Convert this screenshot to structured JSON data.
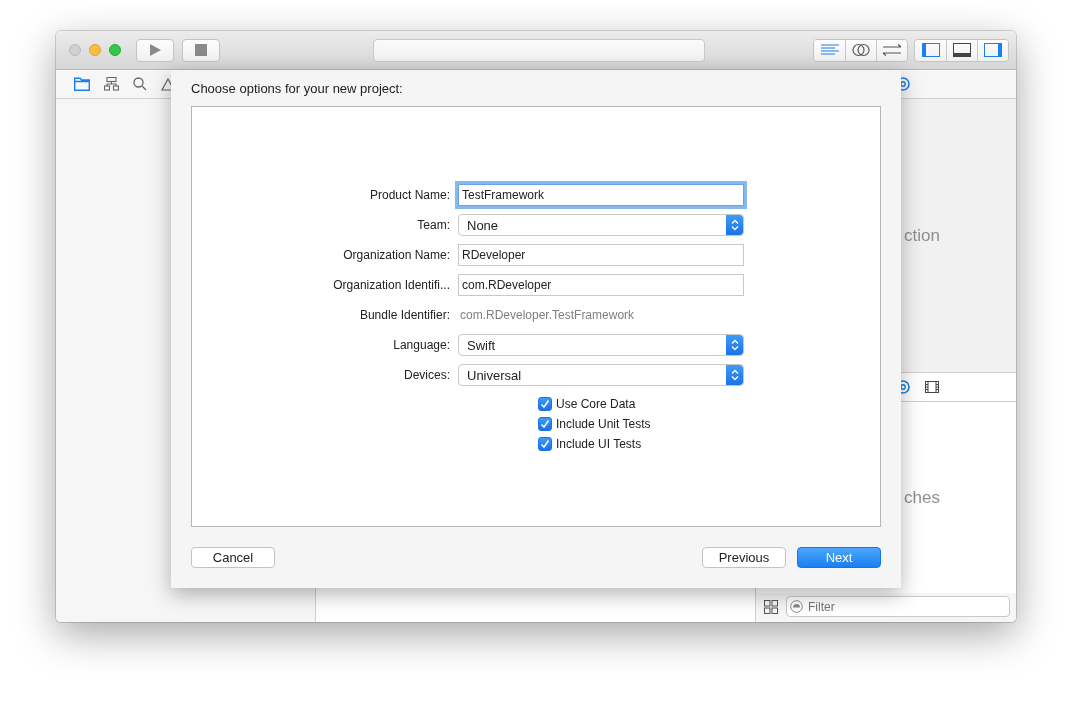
{
  "dialog": {
    "title": "Choose options for your new project:",
    "fields": [
      {
        "kind": "text",
        "label": "Product Name:",
        "value": "TestFramework",
        "focused": true
      },
      {
        "kind": "popup",
        "label": "Team:",
        "value": "None"
      },
      {
        "kind": "text",
        "label": "Organization Name:",
        "value": "RDeveloper",
        "focused": false
      },
      {
        "kind": "text",
        "label": "Organization Identifi...",
        "value": "com.RDeveloper",
        "focused": false
      },
      {
        "kind": "static",
        "label": "Bundle Identifier:",
        "value": "com.RDeveloper.TestFramework"
      },
      {
        "kind": "popup",
        "label": "Language:",
        "value": "Swift"
      },
      {
        "kind": "popup",
        "label": "Devices:",
        "value": "Universal"
      }
    ],
    "checkboxes": [
      {
        "label": "Use Core Data",
        "checked": true
      },
      {
        "label": "Include Unit Tests",
        "checked": true
      },
      {
        "label": "Include UI Tests",
        "checked": true
      }
    ],
    "buttons": [
      {
        "label": "Cancel",
        "kind": "normal"
      },
      {
        "label": "Previous",
        "kind": "normal"
      },
      {
        "label": "Next",
        "kind": "default"
      }
    ]
  },
  "inspector": {
    "upper_text": "ction",
    "lower_text": "ches",
    "filter": {
      "placeholder": "Filter"
    }
  }
}
